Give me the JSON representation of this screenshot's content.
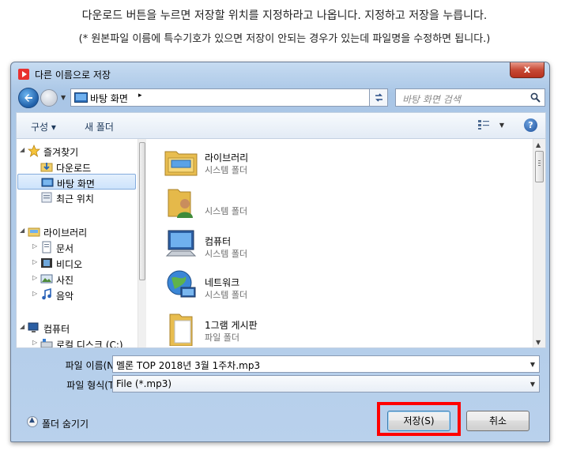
{
  "caption": {
    "line1": "다운로드 버튼을 누르면 저장할 위치를 지정하라고 나옵니다. 지정하고 저장을 누릅니다.",
    "line2": "(* 원본파일 이름에 특수기호가 있으면 저장이 안되는 경우가 있는데 파일명을 수정하면 됩니다.)"
  },
  "dialog": {
    "title": "다른 이름으로 저장",
    "close_label": "x"
  },
  "address": {
    "location": "바탕 화면",
    "separator": "▸"
  },
  "search": {
    "placeholder": "바탕 화면 검색"
  },
  "toolbar": {
    "organize": "구성 ▾",
    "new_folder": "새 폴더",
    "help": "?"
  },
  "nav": {
    "favorites": "즐겨찾기",
    "downloads": "다운로드",
    "desktop": "바탕 화면",
    "recent": "최근 위치",
    "libraries": "라이브러리",
    "documents": "문서",
    "videos": "비디오",
    "pictures": "사진",
    "music": "음악",
    "computer": "컴퓨터",
    "local_disk": "로컬 디스크 (C:)"
  },
  "files": [
    {
      "name": "라이브러리",
      "type": "시스템 폴더",
      "icon": "library-icon"
    },
    {
      "name": "",
      "type": "시스템 폴더",
      "icon": "user-folder-icon"
    },
    {
      "name": "컴퓨터",
      "type": "시스템 폴더",
      "icon": "computer-icon"
    },
    {
      "name": "네트워크",
      "type": "시스템 폴더",
      "icon": "network-icon"
    },
    {
      "name": "1그램 게시판",
      "type": "파일 폴더",
      "icon": "folder-icon"
    }
  ],
  "form": {
    "filename_label": "파일 이름(N):",
    "filename_value": "멜론 TOP 2018년 3월 1주차.mp3",
    "filetype_label": "파일 형식(T):",
    "filetype_value": "File (*.mp3)"
  },
  "footer": {
    "hide_folders": "폴더 숨기기",
    "save": "저장(S)",
    "cancel": "취소"
  },
  "colors": {
    "highlight": "#ff0000",
    "titlebar": "#b9d1ec",
    "close_button": "#c74a36"
  }
}
